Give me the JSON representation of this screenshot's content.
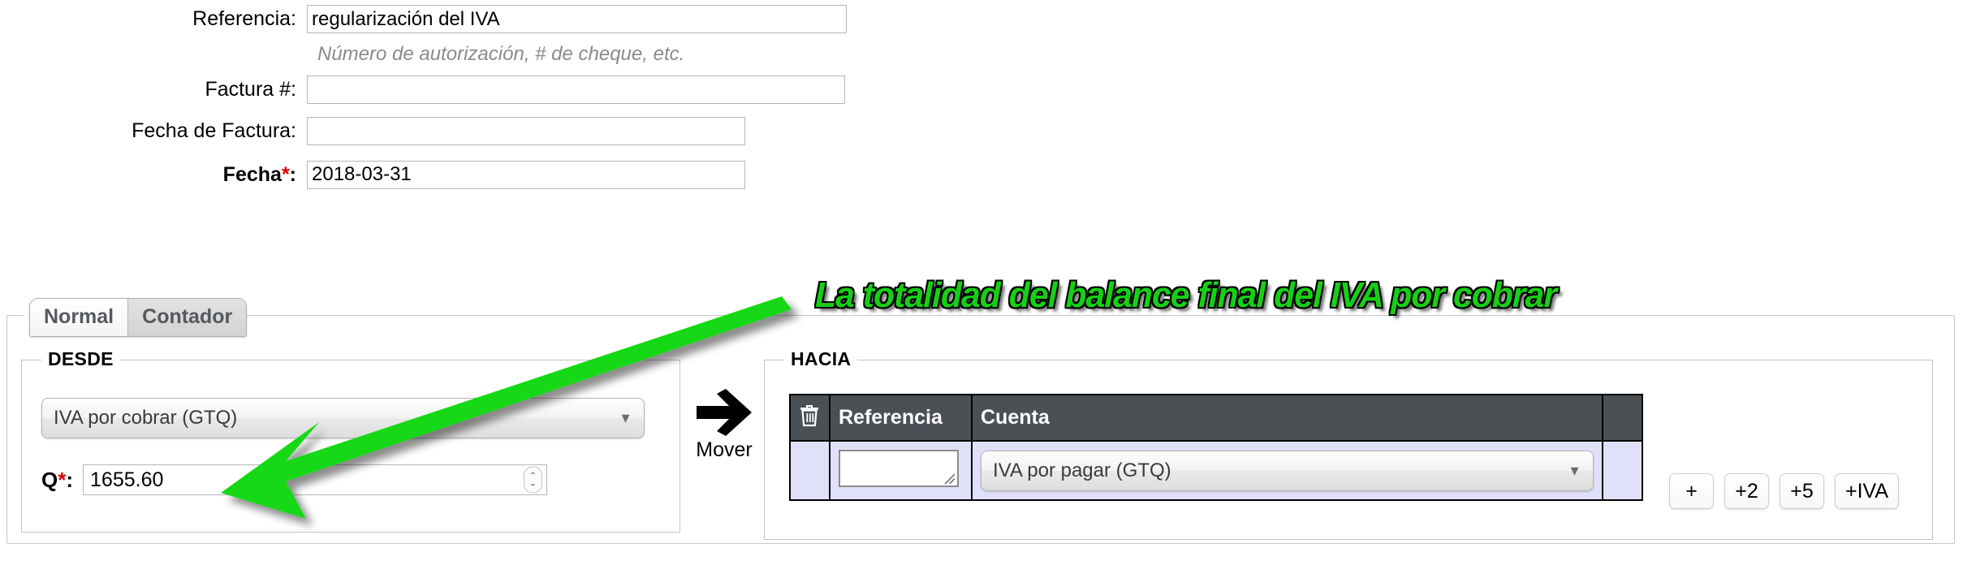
{
  "form": {
    "fields": [
      {
        "label": "Referencia:",
        "value": "regularización del IVA",
        "placeholder": "",
        "required": false
      },
      {
        "label": "Factura #:",
        "value": "",
        "placeholder": "",
        "required": false
      },
      {
        "label": "Fecha de Factura:",
        "value": "",
        "placeholder": "",
        "required": false
      },
      {
        "label": "Fecha",
        "value": "2018-03-31",
        "placeholder": "",
        "required": true
      }
    ],
    "fecha_label_base": "Fecha",
    "fecha_label_star": "*",
    "fecha_label_colon": ":",
    "reference_helper": "Número de autorización, # de cheque, etc."
  },
  "tabs": {
    "items": [
      {
        "label": "Normal",
        "selected": true
      },
      {
        "label": "Contador",
        "selected": false
      }
    ]
  },
  "desde": {
    "legend": "DESDE",
    "account_select": {
      "value": "IVA por cobrar (GTQ)",
      "arrow": "chevron-down-icon"
    },
    "amount": {
      "label_base": "Q",
      "label_star": "*",
      "label_colon": ":",
      "value": "1655.60",
      "spinner_up": "▲",
      "spinner_down": "▼"
    }
  },
  "mover": {
    "label": "Mover",
    "icon": "arrow-right-icon"
  },
  "hacia": {
    "legend": "HACIA",
    "table": {
      "headers": [
        "trash-icon",
        "Referencia",
        "Cuenta",
        ""
      ],
      "header_labels": {
        "trash": "",
        "referencia": "Referencia",
        "cuenta": "Cuenta",
        "extra": ""
      },
      "rows": [
        {
          "referencia": "",
          "referencia_placeholder": "",
          "cuenta": "IVA por pagar (GTQ)"
        }
      ]
    },
    "row_buttons": [
      {
        "label": "+"
      },
      {
        "label": "+2"
      },
      {
        "label": "+5"
      },
      {
        "label": "+IVA"
      }
    ]
  },
  "annotation": {
    "text": "La totalidad del balance final del IVA por cobrar",
    "color": "#16d016",
    "outline": "#000000",
    "arrow": "green-arrow"
  },
  "colors": {
    "table_header_bg": "#4b5055",
    "table_row_bg": "#e0e0f8",
    "required_star": "#d40000",
    "helper_text": "#8a8a8a"
  }
}
